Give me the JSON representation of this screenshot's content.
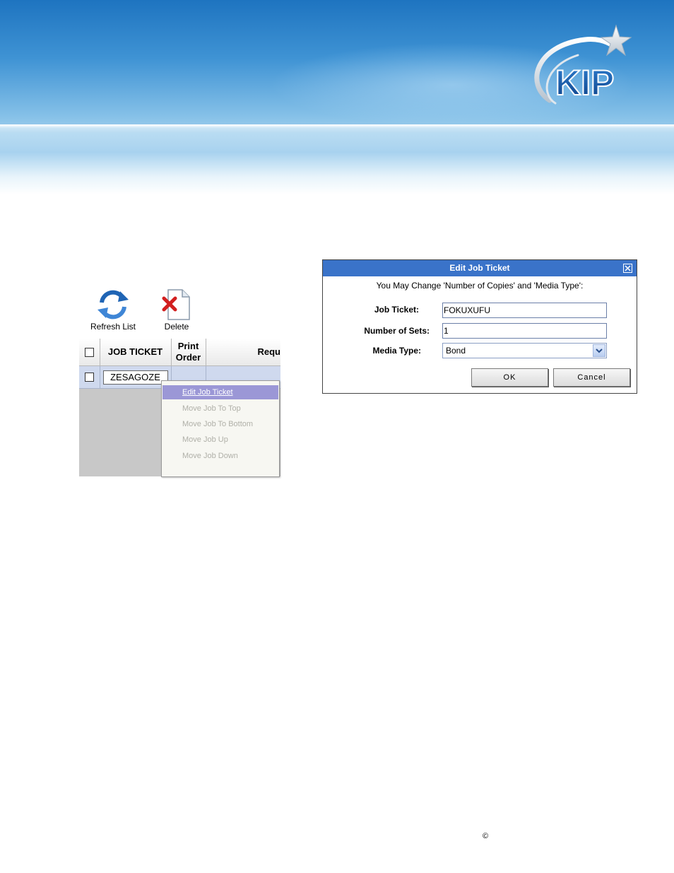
{
  "toolbar": {
    "refresh_label": "Refresh List",
    "delete_label": "Delete",
    "refresh_icon": "refresh-icon",
    "delete_icon": "delete-document-icon"
  },
  "queue_table": {
    "columns": [
      "JOB TICKET",
      "Print Order",
      "Requ"
    ],
    "rows": [
      {
        "job_ticket": "ZESAGOZE"
      }
    ]
  },
  "context_menu": {
    "items": [
      {
        "label": "Edit Job Ticket",
        "active": true
      },
      {
        "label": "Move Job To Top",
        "active": false
      },
      {
        "label": "Move Job To Bottom",
        "active": false
      },
      {
        "label": "Move Job Up",
        "active": false
      },
      {
        "label": "Move Job Down",
        "active": false
      }
    ]
  },
  "dialog": {
    "title": "Edit Job Ticket",
    "message": "You May Change 'Number of Copies' and 'Media Type':",
    "job_ticket_label": "Job Ticket:",
    "job_ticket_value": "FOKUXUFU",
    "sets_label": "Number of Sets:",
    "sets_value": "1",
    "media_label": "Media Type:",
    "media_value": "Bond",
    "ok_label": "OK",
    "cancel_label": "Cancel"
  },
  "footer": {
    "copyright_symbol": "©"
  },
  "logo": {
    "text": "KIP"
  },
  "colors": {
    "dialog_title_bar": "#3a73c9",
    "menu_highlight": "#9b97d6",
    "row_selected": "#cfd9ee"
  }
}
